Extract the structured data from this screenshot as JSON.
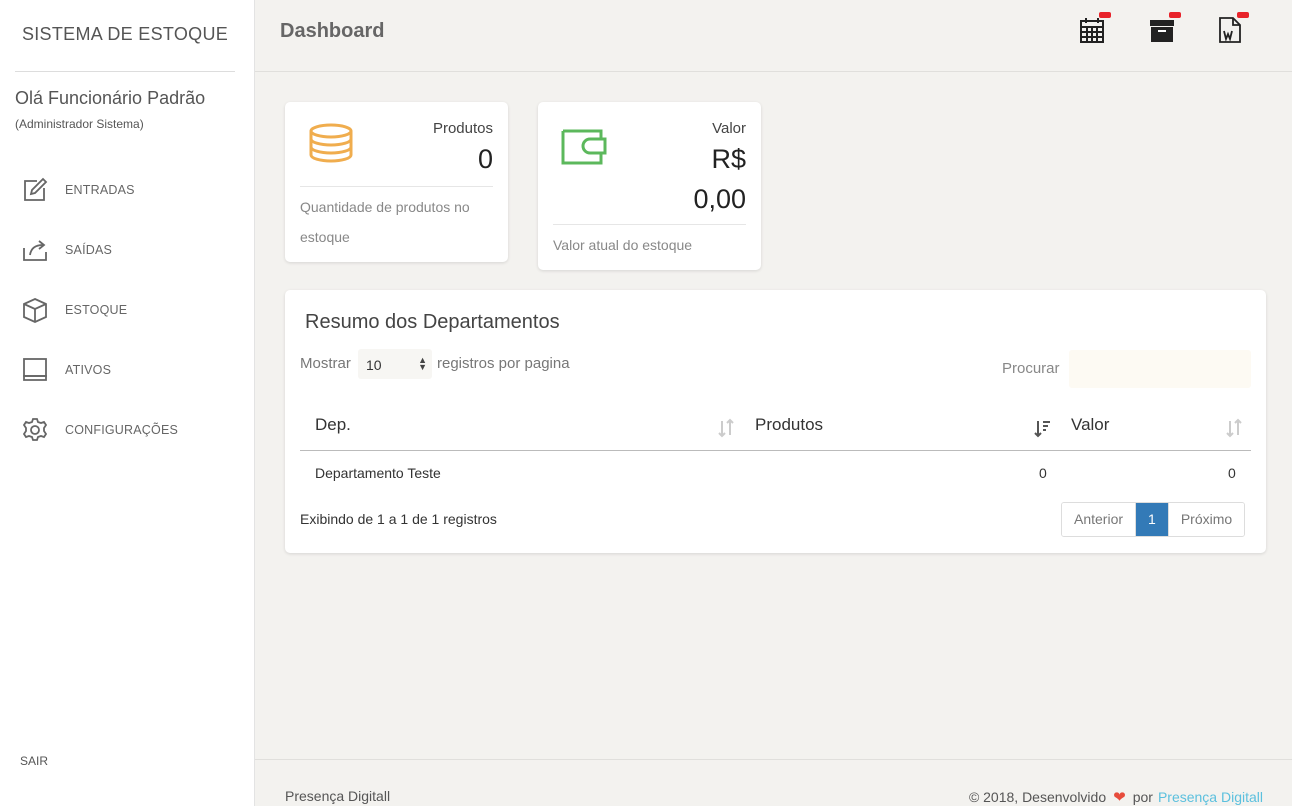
{
  "sidebar": {
    "brand": "SISTEMA DE ESTOQUE",
    "user_greeting": "Olá Funcionário Padrão",
    "user_role": "(Administrador Sistema)",
    "items": [
      {
        "label": "ENTRADAS",
        "icon": "edit-icon"
      },
      {
        "label": "SAÍDAS",
        "icon": "share-icon"
      },
      {
        "label": "ESTOQUE",
        "icon": "box-icon"
      },
      {
        "label": "ATIVOS",
        "icon": "laptop-icon"
      },
      {
        "label": "CONFIGURAÇÕES",
        "icon": "gear-icon"
      }
    ],
    "logout": "SAIR"
  },
  "header": {
    "title": "Dashboard",
    "icons": [
      "calendar-icon",
      "archive-icon",
      "word-file-icon"
    ],
    "badge_color": "#e8232a"
  },
  "cards": {
    "produtos": {
      "title": "Produtos",
      "value": "0",
      "desc": "Quantidade de produtos no estoque",
      "icon": "coins-icon",
      "icon_color": "#f0ad4e"
    },
    "valor": {
      "title": "Valor",
      "value_currency": "R$",
      "value_amount": "0,00",
      "desc": "Valor atual do estoque",
      "icon": "wallet-icon",
      "icon_color": "#5cb85c"
    }
  },
  "table": {
    "title": "Resumo dos Departamentos",
    "show_label": "Mostrar",
    "page_size": "10",
    "show_suffix": "registros por pagina",
    "search_label": "Procurar",
    "search_value": "",
    "columns": [
      "Dep.",
      "Produtos",
      "Valor"
    ],
    "rows": [
      {
        "dep": "Departamento Teste",
        "produtos": "0",
        "valor": "0"
      }
    ],
    "info": "Exibindo de 1 a 1 de 1 registros",
    "pagination": {
      "prev": "Anterior",
      "current": "1",
      "next": "Próximo"
    }
  },
  "footer": {
    "left": "Presença Digitall",
    "right_prefix": "© 2018, Desenvolvido",
    "right_by": "por",
    "right_link": "Presença Digitall"
  }
}
